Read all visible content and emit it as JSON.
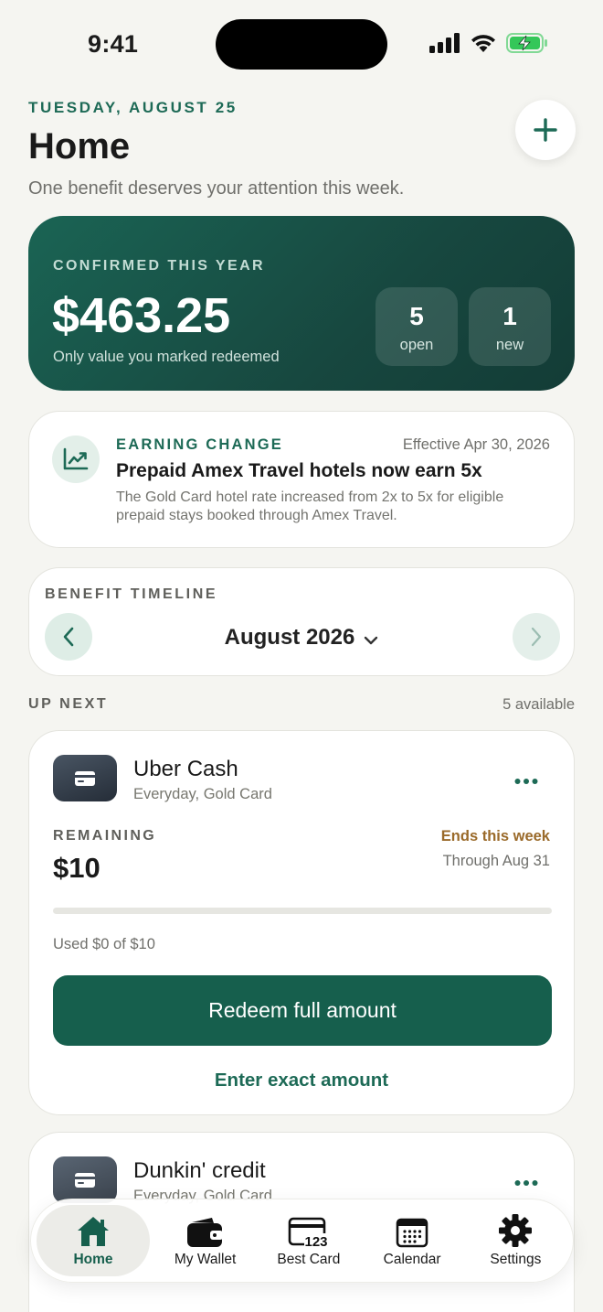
{
  "status_bar": {
    "time": "9:41"
  },
  "header": {
    "date": "TUESDAY, AUGUST 25",
    "title": "Home",
    "subtitle": "One benefit deserves your attention this week."
  },
  "summary": {
    "label": "CONFIRMED THIS YEAR",
    "amount": "$463.25",
    "note": "Only value you marked redeemed",
    "stats": [
      {
        "value": "5",
        "label": "open"
      },
      {
        "value": "1",
        "label": "new"
      }
    ]
  },
  "earning_change": {
    "tag": "EARNING CHANGE",
    "effective": "Effective Apr 30, 2026",
    "title": "Prepaid Amex Travel hotels now earn 5x",
    "description": "The Gold Card hotel rate increased from 2x to 5x for eligible prepaid stays booked through Amex Travel."
  },
  "timeline": {
    "label": "BENEFIT TIMELINE",
    "month": "August 2026"
  },
  "up_next": {
    "label": "UP NEXT",
    "count": "5 available"
  },
  "benefits": [
    {
      "name": "Uber Cash",
      "subtitle": "Everyday, Gold Card",
      "remaining_label": "REMAINING",
      "remaining": "$10",
      "ends": "Ends this week",
      "through": "Through Aug 31",
      "used": "Used $0 of $10",
      "progress": 0,
      "redeem_label": "Redeem full amount",
      "exact_label": "Enter exact amount"
    },
    {
      "name": "Dunkin' credit",
      "subtitle": "Everyday, Gold Card"
    }
  ],
  "tabs": [
    {
      "label": "Home",
      "icon": "house-icon"
    },
    {
      "label": "My Wallet",
      "icon": "wallet-icon"
    },
    {
      "label": "Best Card",
      "icon": "card-123-icon"
    },
    {
      "label": "Calendar",
      "icon": "calendar-icon"
    },
    {
      "label": "Settings",
      "icon": "gear-icon"
    }
  ],
  "colors": {
    "accent": "#1d6a56",
    "hero_bg": "#17473f",
    "warning": "#9a6a2a",
    "background": "#f5f5f1"
  }
}
